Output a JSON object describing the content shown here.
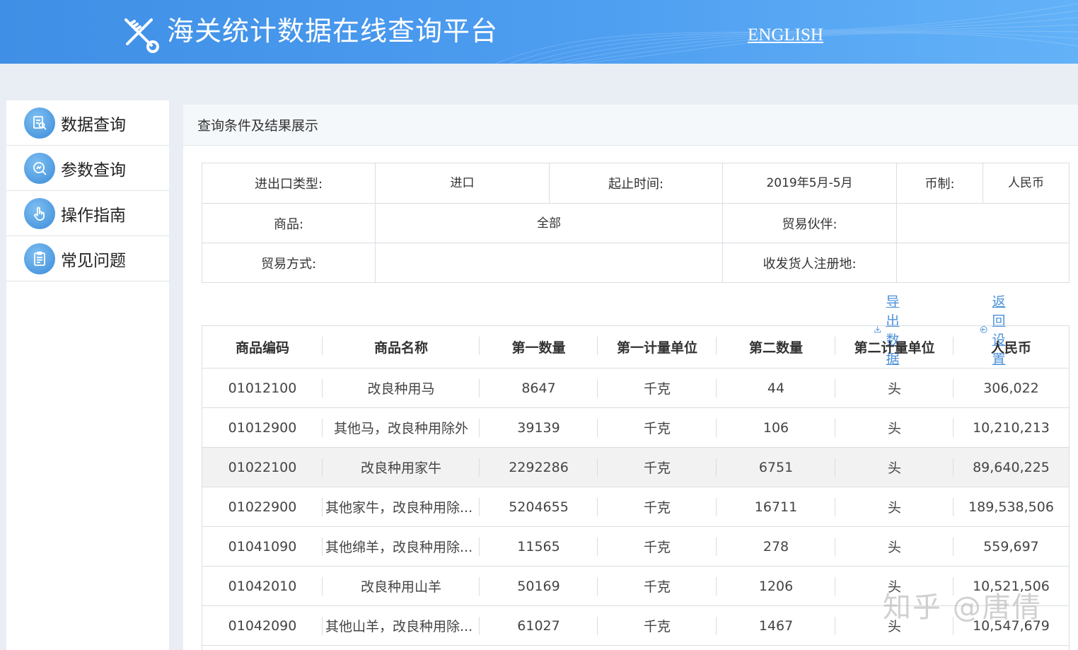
{
  "header": {
    "title": "海关统计数据在线查询平台",
    "english_link": "ENGLISH",
    "logo_icon": "customs-key-logo-icon"
  },
  "sidebar": {
    "items": [
      {
        "label": "数据查询",
        "icon": "data-search-icon"
      },
      {
        "label": "参数查询",
        "icon": "param-search-icon"
      },
      {
        "label": "操作指南",
        "icon": "hand-pointer-icon"
      },
      {
        "label": "常见问题",
        "icon": "clipboard-icon"
      }
    ]
  },
  "panel": {
    "title": "查询条件及结果展示"
  },
  "conditions": {
    "trade_type_label": "进出口类型:",
    "trade_type_value": "进口",
    "period_label": "起止时间:",
    "period_value": "2019年5月-5月",
    "currency_label": "币制:",
    "currency_value": "人民币",
    "goods_label": "商品:",
    "goods_value": "全部",
    "partner_label": "贸易伙伴:",
    "partner_value": "",
    "mode_label": "贸易方式:",
    "mode_value": "",
    "region_label": "收发货人注册地:",
    "region_value": ""
  },
  "actions": {
    "export_label": "导出数据",
    "back_label": "返回设置"
  },
  "table": {
    "columns": [
      "商品编码",
      "商品名称",
      "第一数量",
      "第一计量单位",
      "第二数量",
      "第二计量单位",
      "人民币"
    ],
    "rows": [
      [
        "01012100",
        "改良种用马",
        "8647",
        "千克",
        "44",
        "头",
        "306,022"
      ],
      [
        "01012900",
        "其他马，改良种用除外",
        "39139",
        "千克",
        "106",
        "头",
        "10,210,213"
      ],
      [
        "01022100",
        "改良种用家牛",
        "2292286",
        "千克",
        "6751",
        "头",
        "89,640,225"
      ],
      [
        "01022900",
        "其他家牛，改良种用除...",
        "5204655",
        "千克",
        "16711",
        "头",
        "189,538,506"
      ],
      [
        "01041090",
        "其他绵羊，改良种用除...",
        "11565",
        "千克",
        "278",
        "头",
        "559,697"
      ],
      [
        "01042010",
        "改良种用山羊",
        "50169",
        "千克",
        "1206",
        "头",
        "10,521,506"
      ],
      [
        "01042090",
        "其他山羊，改良种用除...",
        "61027",
        "千克",
        "1467",
        "头",
        "10,547,679"
      ]
    ]
  },
  "watermark": "知乎 @唐倩",
  "colors": {
    "header_blue": "#4c9cf0",
    "link_blue": "#4a90d9",
    "icon_blue": "#3a8ad8"
  }
}
